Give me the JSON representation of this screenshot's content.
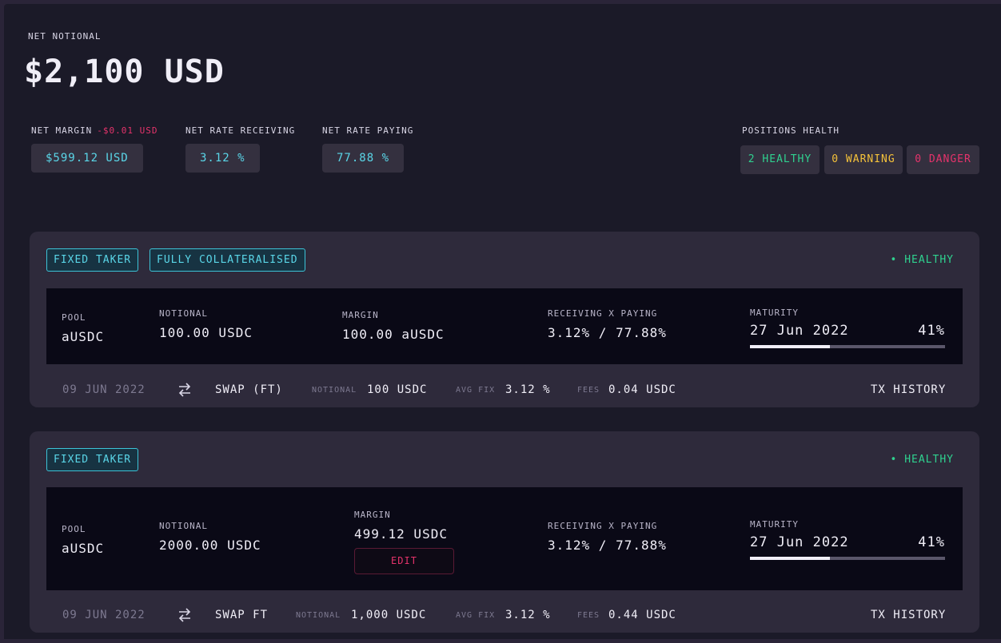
{
  "header": {
    "net_notional_label": "NET NOTIONAL",
    "net_notional_value": "$2,100 USD"
  },
  "stats": {
    "net_margin_label": "NET MARGIN",
    "net_margin_change": "-$0.01 USD",
    "net_margin_value": "$599.12 USD",
    "rate_receiving_label": "NET RATE RECEIVING",
    "rate_receiving_value": "3.12 %",
    "rate_paying_label": "NET RATE PAYING",
    "rate_paying_value": "77.88 %"
  },
  "health": {
    "label": "POSITIONS HEALTH",
    "healthy": "2 HEALTHY",
    "warning": "0 WARNING",
    "danger": "0 DANGER",
    "colors": {
      "healthy": "#2fd18f",
      "warning": "#f5c23a",
      "danger": "#e5336b"
    }
  },
  "positions": [
    {
      "tags": [
        "FIXED TAKER",
        "FULLY COLLATERALISED"
      ],
      "status": "• HEALTHY",
      "pool_label": "POOL",
      "pool": "aUSDC",
      "notional_label": "NOTIONAL",
      "notional": "100.00 USDC",
      "margin_label": "MARGIN",
      "margin": "100.00 aUSDC",
      "rates_label": "RECEIVING X PAYING",
      "rates": "3.12% / 77.88%",
      "maturity_label": "MATURITY",
      "maturity_date": "27 Jun 2022",
      "maturity_pct": "41%",
      "maturity_progress": 0.41,
      "footer": {
        "date": "09 JUN 2022",
        "action": "SWAP (FT)",
        "notional_label": "NOTIONAL",
        "notional": "100 USDC",
        "avg_fix_label": "AVG FIX",
        "avg_fix": "3.12 %",
        "fees_label": "FEES",
        "fees": "0.04 USDC",
        "tx_history": "TX HISTORY"
      }
    },
    {
      "tags": [
        "FIXED TAKER"
      ],
      "status": "• HEALTHY",
      "pool_label": "POOL",
      "pool": "aUSDC",
      "notional_label": "NOTIONAL",
      "notional": "2000.00 USDC",
      "margin_label": "MARGIN",
      "margin": "499.12 USDC",
      "edit": "EDIT",
      "rates_label": "RECEIVING X PAYING",
      "rates": "3.12% / 77.88%",
      "maturity_label": "MATURITY",
      "maturity_date": "27 Jun 2022",
      "maturity_pct": "41%",
      "maturity_progress": 0.41,
      "footer": {
        "date": "09 JUN 2022",
        "action": "SWAP FT",
        "notional_label": "NOTIONAL",
        "notional": "1,000 USDC",
        "avg_fix_label": "AVG FIX",
        "avg_fix": "3.12 %",
        "fees_label": "FEES",
        "fees": "0.44 USDC",
        "tx_history": "TX HISTORY"
      }
    }
  ]
}
